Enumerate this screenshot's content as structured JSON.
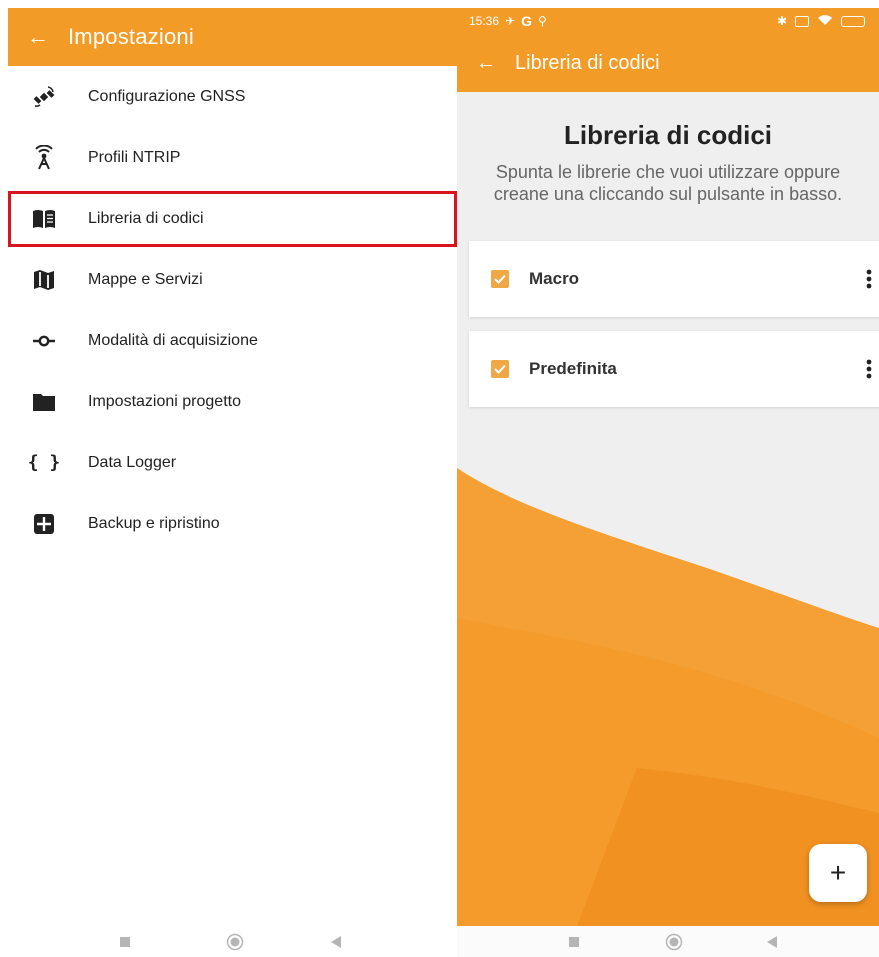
{
  "settings": {
    "title": "Impostazioni",
    "items": [
      {
        "label": "Configurazione GNSS",
        "icon": "satellite-icon"
      },
      {
        "label": "Profili NTRIP",
        "icon": "antenna-icon"
      },
      {
        "label": "Libreria di codici",
        "icon": "book-icon",
        "highlighted": true
      },
      {
        "label": "Mappe e Servizi",
        "icon": "map-icon"
      },
      {
        "label": "Modalità di acquisizione",
        "icon": "commit-icon"
      },
      {
        "label": "Impostazioni progetto",
        "icon": "folder-icon"
      },
      {
        "label": "Data Logger",
        "icon": "braces-icon"
      },
      {
        "label": "Backup e ripristino",
        "icon": "grid-icon"
      }
    ]
  },
  "status_bar": {
    "time": "15:36",
    "carrier_letter": "G"
  },
  "library": {
    "appbar_title": "Libreria di codici",
    "heading": "Libreria di codici",
    "subtitle": "Spunta le librerie che vuoi utilizzare oppure creane una cliccando sul pulsante in basso.",
    "items": [
      {
        "name": "Macro",
        "checked": true
      },
      {
        "name": "Predefinita",
        "checked": true
      }
    ],
    "fab_label": "+"
  },
  "colors": {
    "accent": "#f29b26",
    "highlight_border": "#d8151d",
    "checkbox": "#f0a746"
  }
}
